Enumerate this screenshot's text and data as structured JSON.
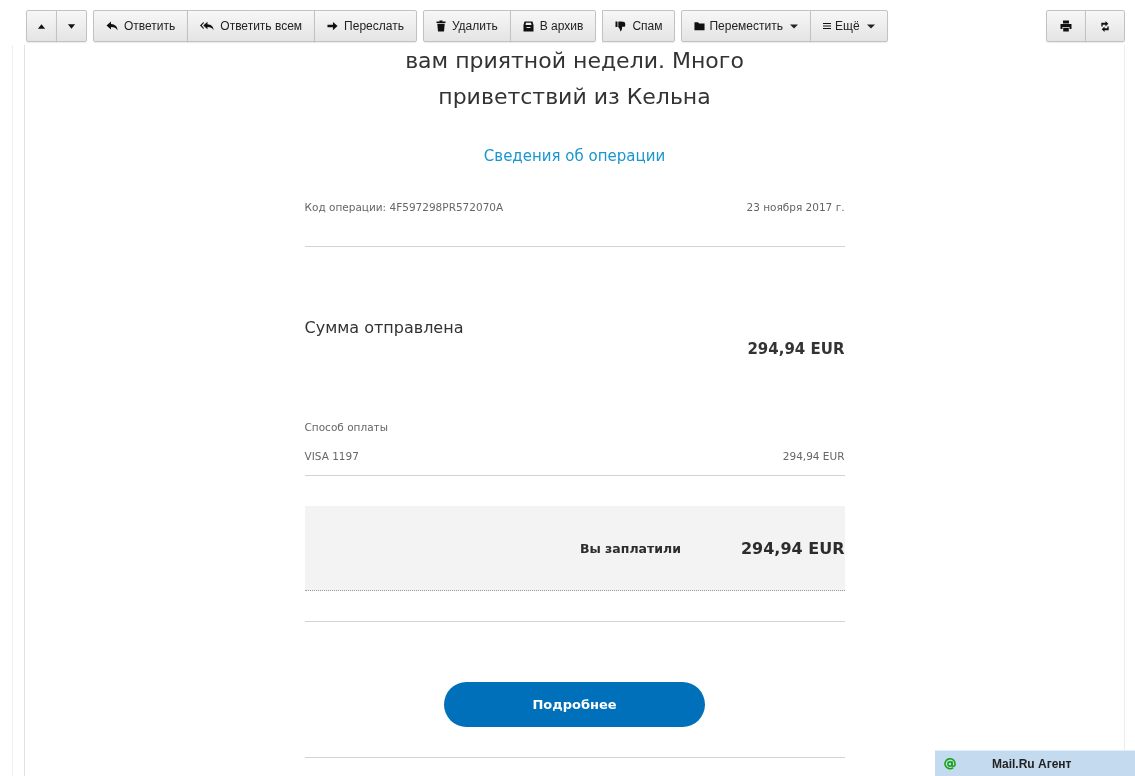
{
  "toolbar": {
    "groups": [
      {
        "buttons": [
          {
            "kind": "icon",
            "dropdown": false
          },
          {
            "kind": "icon",
            "dropdown": false
          }
        ]
      },
      {
        "buttons": [
          {
            "kind": "text",
            "label": "Ответить",
            "dropdown": false
          },
          {
            "kind": "text",
            "label": "Ответить всем",
            "dropdown": false
          },
          {
            "kind": "text",
            "label": "Переслать",
            "dropdown": false
          }
        ]
      },
      {
        "buttons": [
          {
            "kind": "text",
            "label": "Удалить",
            "dropdown": false
          },
          {
            "kind": "text",
            "label": "В архив",
            "dropdown": false
          }
        ]
      },
      {
        "buttons": [
          {
            "kind": "text",
            "label": "Спам",
            "dropdown": false
          }
        ]
      },
      {
        "buttons": [
          {
            "kind": "text",
            "label": "Переместить",
            "dropdown": true
          },
          {
            "kind": "text",
            "label": "Ещё",
            "dropdown": true
          }
        ]
      }
    ],
    "right_group": {
      "buttons": [
        {
          "kind": "icon",
          "dropdown": false
        },
        {
          "kind": "icon",
          "dropdown": false
        }
      ]
    }
  },
  "message": {
    "heading": "вам приятной недели. Много приветствий из Кельна",
    "details_link": "Сведения об операции",
    "operation_code": "Код операции: 4F597298PR572070A",
    "date": "23 ноября 2017 г.",
    "amount_sent": {
      "label": "Сумма отправлена",
      "value": "294,94 EUR"
    },
    "payment_method": {
      "label": "Способ оплаты",
      "card": "VISA 1197",
      "amount": "294,94 EUR"
    },
    "total": {
      "label": "Вы заплатили",
      "value": "294,94 EUR"
    },
    "details_button": "Подробнее"
  },
  "agent_bar": {
    "label": "Mail.Ru Агент"
  }
}
